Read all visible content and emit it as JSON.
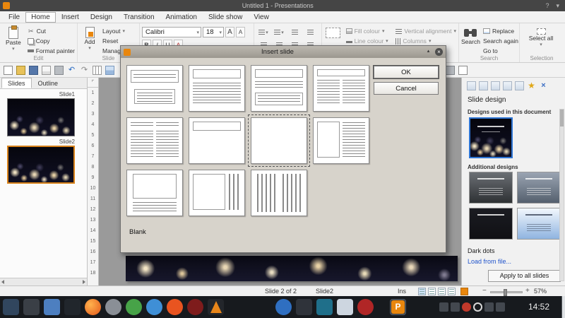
{
  "colors": {
    "accent": "#e8860d",
    "selection_blue": "#2e75d4"
  },
  "titlebar": {
    "title": "Untitled 1 - Presentations"
  },
  "menubar": {
    "items": [
      "File",
      "Home",
      "Insert",
      "Design",
      "Transition",
      "Animation",
      "Slide show",
      "View"
    ],
    "active": "Home"
  },
  "ribbon": {
    "edit": {
      "label": "Edit",
      "paste": "Paste",
      "cut": "Cut",
      "copy": "Copy",
      "format_painter": "Format painter"
    },
    "slide": {
      "label": "Slide",
      "add": "Add",
      "layout": "Layout",
      "reset": "Reset",
      "manage": "Manage"
    },
    "font": {
      "family": "Calibri",
      "size": "18",
      "buttons": [
        "B",
        "I",
        "U",
        "A"
      ]
    },
    "objects": {
      "fill": "Fill colour",
      "line": "Line colour",
      "valign": "Vertical alignment",
      "columns": "Columns"
    },
    "search": {
      "label": "Search",
      "search": "Search",
      "replace": "Replace",
      "again": "Search again",
      "goto": "Go to"
    },
    "selection": {
      "label": "Selection",
      "select_all": "Select all"
    }
  },
  "slides_panel": {
    "tabs": [
      "Slides",
      "Outline"
    ],
    "slides": [
      "Slide1",
      "Slide2"
    ]
  },
  "ruler": {
    "numbers": [
      "1",
      "2",
      "3",
      "4",
      "5",
      "6",
      "7",
      "8",
      "9",
      "10",
      "11",
      "12",
      "13",
      "14",
      "15",
      "16",
      "17",
      "18"
    ]
  },
  "dialog": {
    "title": "Insert slide",
    "ok": "OK",
    "cancel": "Cancel",
    "selected_layout": "Blank"
  },
  "sidebar": {
    "title": "Slide design",
    "used_heading": "Designs used in this document",
    "additional_heading": "Additional designs",
    "design_name": "Dark dots",
    "load_link": "Load from file...",
    "apply_button": "Apply to all slides"
  },
  "statusbar": {
    "slide_info": "Slide 2 of 2",
    "slide_name": "Slide2",
    "insert_mode": "Ins",
    "zoom_level": "57%"
  },
  "taskbar": {
    "app_letter": "P",
    "time": "14:52"
  }
}
